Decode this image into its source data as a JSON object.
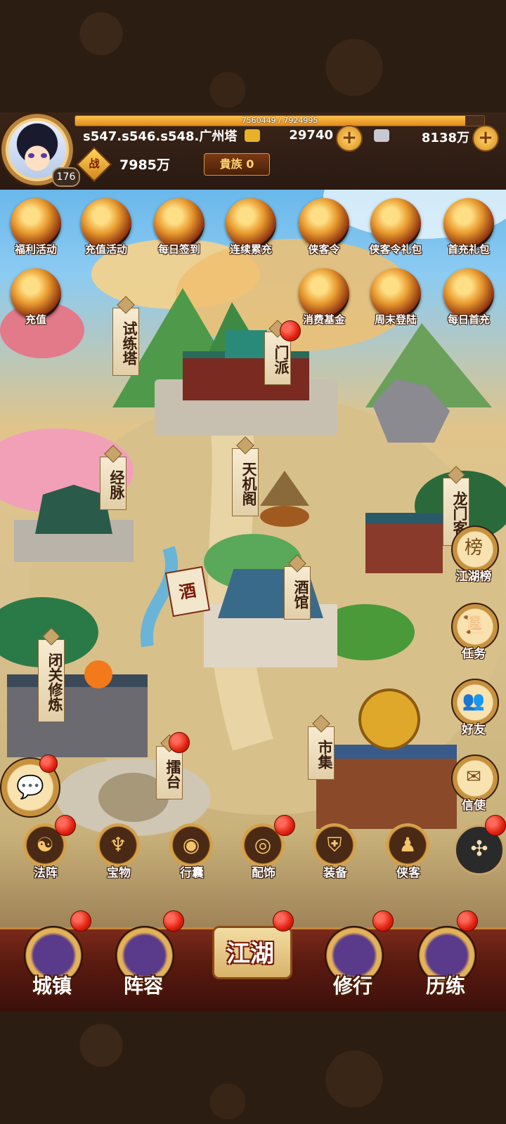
{
  "hud": {
    "exp": "7560449 / 7924995",
    "exp_fraction": 0.954,
    "level": "176",
    "server": "s547.s546.s548.广州塔",
    "currency1": "29740",
    "currency2": "8138万",
    "power_icon": "战",
    "power": "7985万",
    "noble": "貴族 0"
  },
  "activities": [
    {
      "label": "福利活动",
      "icon": "money-bag-icon"
    },
    {
      "label": "充值活动",
      "icon": "ticket-icon"
    },
    {
      "label": "每日签到",
      "icon": "ticket-icon"
    },
    {
      "label": "连续累充",
      "icon": "gift-icon"
    },
    {
      "label": "侠客令",
      "icon": "token-icon"
    },
    {
      "label": "侠客令礼包",
      "icon": "bag-icon"
    },
    {
      "label": "首充礼包",
      "icon": "character-icon"
    },
    {
      "label": "充值",
      "icon": "gold-ingot-icon"
    },
    {
      "label": "消费基金",
      "icon": "money-bag-icon"
    },
    {
      "label": "周末登陆",
      "icon": "horn-icon"
    },
    {
      "label": "每日首充",
      "icon": "gold-ingot-icon"
    }
  ],
  "map": {
    "shilianta": "试练塔",
    "menpai": "门派",
    "jingmai": "经脉",
    "tianjige": "天机阁",
    "longmenke": "龙门客",
    "jiuguan": "酒馆",
    "jiu_sign": "酒",
    "biguan": "闭关修炼",
    "leitai": "擂台",
    "shiji": "市集"
  },
  "side": {
    "jianghubang": "江湖榜",
    "bang_icon": "榜",
    "renwu": "任务",
    "haoyou": "好友",
    "xinshi": "信使"
  },
  "functions": [
    "法阵",
    "宝物",
    "行囊",
    "配饰",
    "装备",
    "侠客"
  ],
  "nav": {
    "chengzhen": "城镇",
    "zhenrong": "阵容",
    "jianghu": "江湖",
    "xiuxing": "修行",
    "lilian": "历练"
  }
}
